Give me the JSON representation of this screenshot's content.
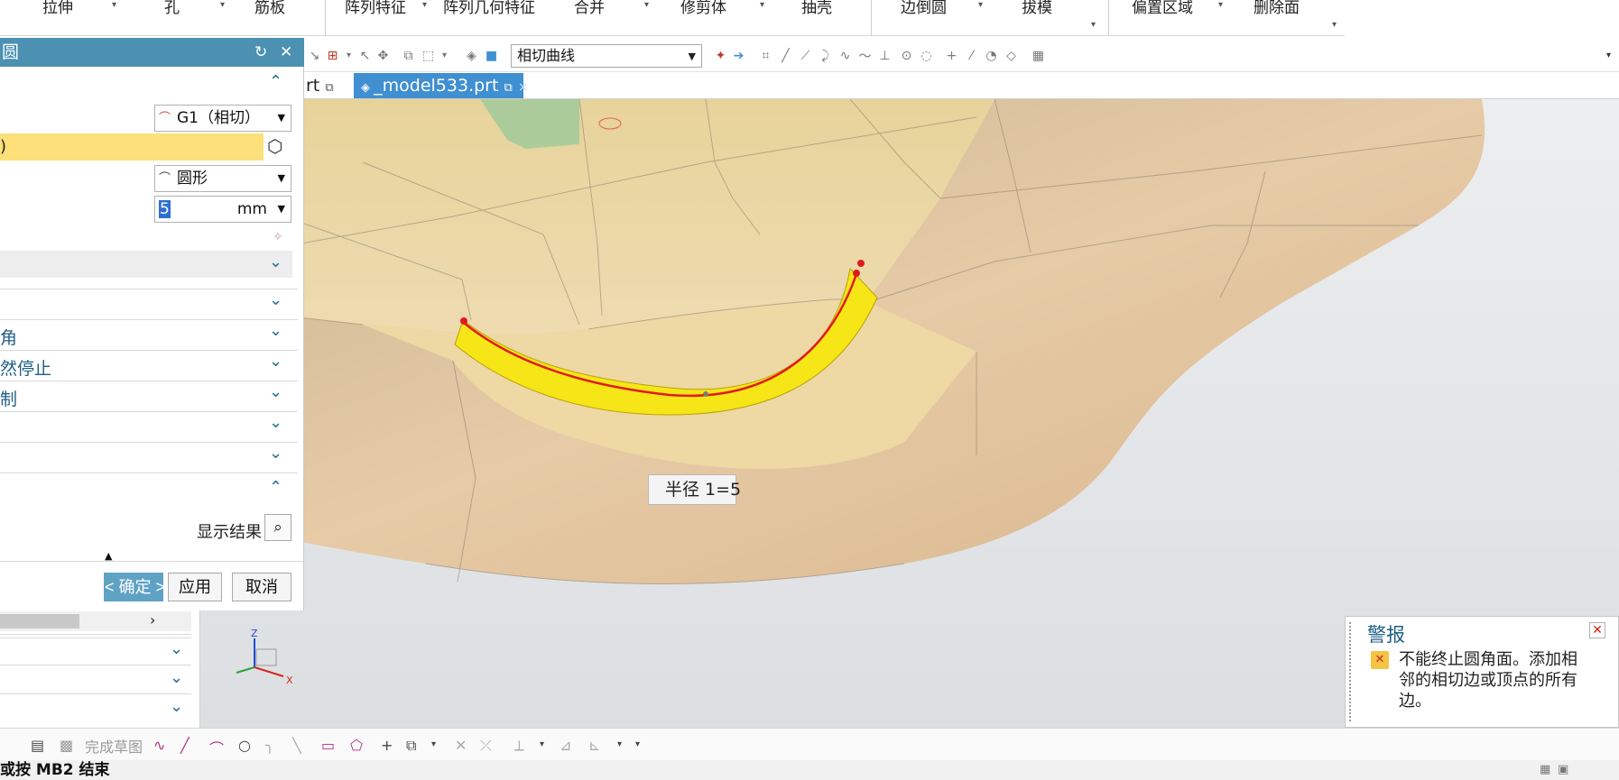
{
  "ribbon": {
    "items": [
      "拉伸",
      "孔",
      "筋板",
      "阵列特征",
      "阵列几何特征",
      "合并",
      "修剪体",
      "抽壳",
      "边倒圆",
      "拔模",
      "偏置区域",
      "删除面"
    ]
  },
  "toolbar": {
    "curve_rule": "相切曲线"
  },
  "tabs": {
    "part_a": "rt",
    "part_b": "_model533.prt"
  },
  "dialog": {
    "title": "圆",
    "continuity": "G1（相切）",
    "highlight_row": ")",
    "shape": "圆形",
    "radius_value": "5",
    "radius_unit": "mm",
    "sections": [
      "角",
      "然停止",
      "制"
    ],
    "show_result": "显示结果",
    "buttons": {
      "ok": "< 确定 >",
      "apply": "应用",
      "cancel": "取消"
    }
  },
  "viewport": {
    "radius_tag": "半径 1=5",
    "triad": {
      "z": "Z",
      "x": "X"
    }
  },
  "alert": {
    "title": "警报",
    "message": "不能终止圆角面。添加相邻的相切边或顶点的所有边。"
  },
  "sketch_toolbar": {
    "finish_sketch": "完成草图"
  },
  "status": {
    "text": "或按 MB2 结束"
  },
  "colors": {
    "dialog_title_bg": "#4c91b2",
    "tab_active_bg": "#3f8fd1",
    "highlight_row_bg": "#fde07a",
    "fillet_yellow": "#f7e617",
    "edge_red": "#e01b1b",
    "surface_tan": "#e3c7a0"
  }
}
